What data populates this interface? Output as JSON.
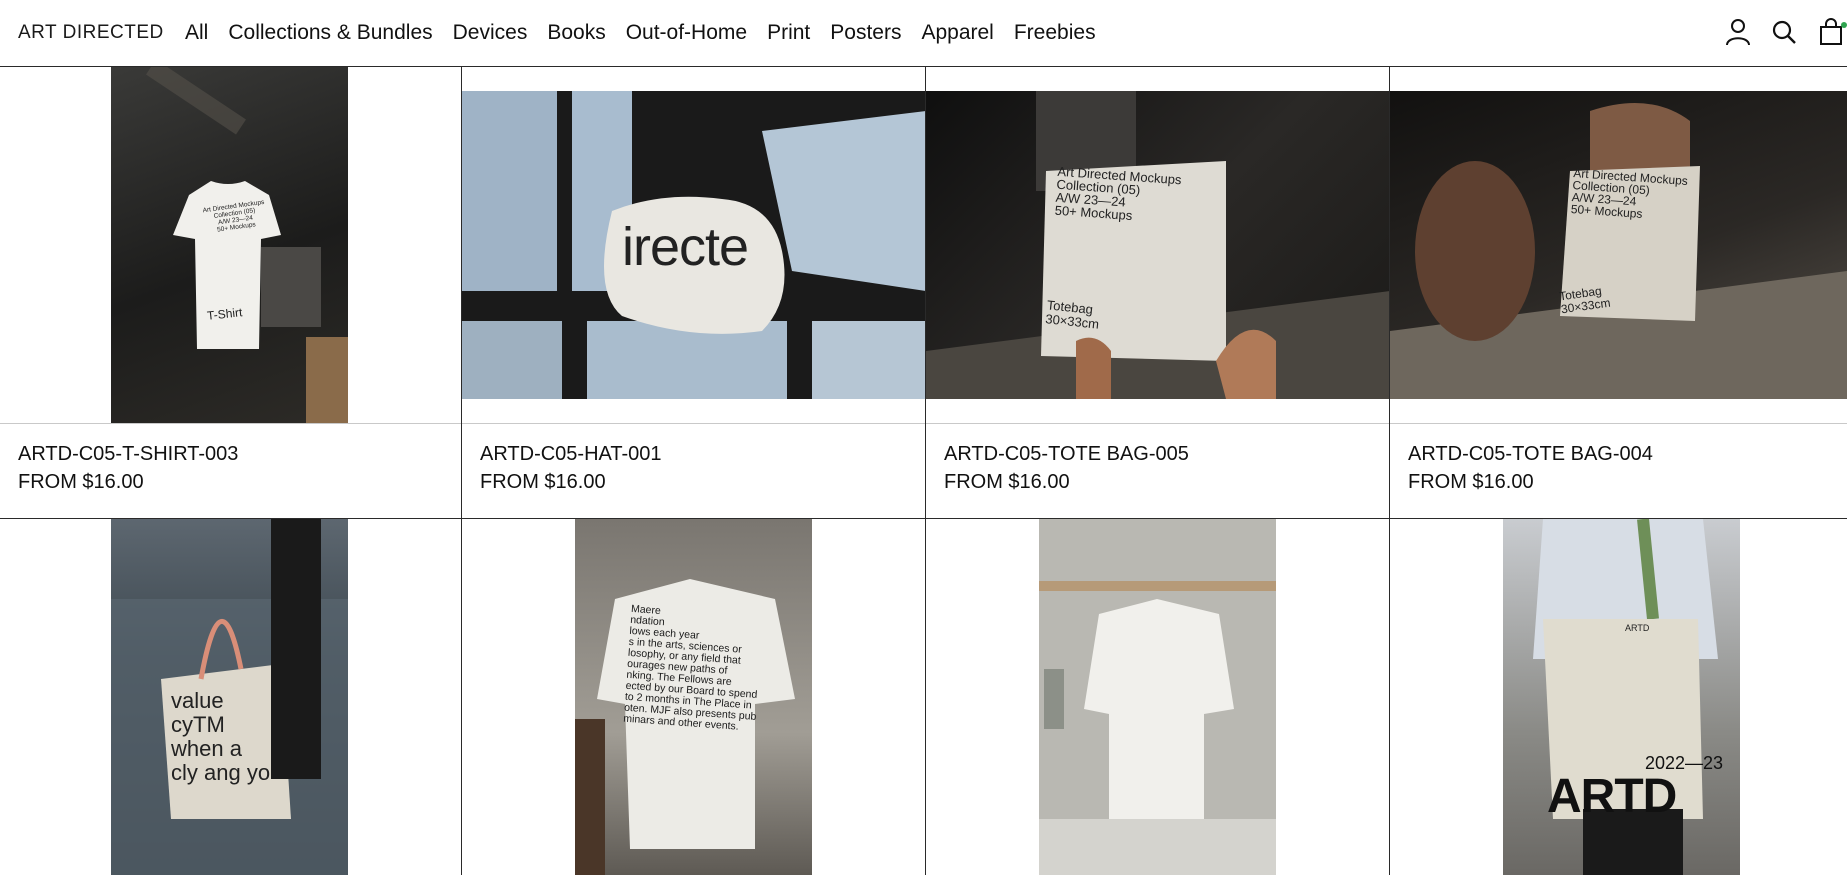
{
  "header": {
    "logo": "ART DIRECTED",
    "nav": [
      "All",
      "Collections & Bundles",
      "Devices",
      "Books",
      "Out-of-Home",
      "Print",
      "Posters",
      "Apparel",
      "Freebies"
    ],
    "icons": [
      "account-icon",
      "search-icon",
      "cart-icon"
    ],
    "cart_indicator_color": "#2ea44f"
  },
  "products": [
    {
      "name": "ARTD-C05-T-SHIRT-003",
      "price": "FROM $16.00",
      "print": [
        "Art Directed Mockups",
        "Collection (05)",
        "A/W 23—24",
        "50+ Mockups",
        "T-Shirt"
      ]
    },
    {
      "name": "ARTD-C05-HAT-001",
      "price": "FROM $16.00",
      "print": [
        "irecte"
      ]
    },
    {
      "name": "ARTD-C05-TOTE BAG-005",
      "price": "FROM $16.00",
      "print": [
        "Art Directed Mockups",
        "Collection (05)",
        "A/W 23—24",
        "50+ Mockups",
        "Totebag",
        "30×33cm"
      ]
    },
    {
      "name": "ARTD-C05-TOTE BAG-004",
      "price": "FROM $16.00",
      "print": [
        "Art Directed Mockups",
        "Collection (05)",
        "A/W 23—24",
        "50+ Mockups",
        "Totebag",
        "30×33cm"
      ]
    }
  ],
  "row2": [
    {
      "print": [
        "value",
        "cyTM",
        "when a",
        "cly ang yo"
      ]
    },
    {
      "print": [
        "Maere",
        "ndation",
        "lows each year",
        "s in the arts, sciences or",
        "losophy, or any field that",
        "ourages new paths of",
        "nking. The Fellows are",
        "ected by our Board to spend",
        "to 2 months in The Place in",
        "oten. MJF also presents pub",
        "minars and other events."
      ]
    },
    {
      "print": []
    },
    {
      "print": [
        "ARTD",
        "2022—23",
        "ARTD"
      ]
    }
  ]
}
